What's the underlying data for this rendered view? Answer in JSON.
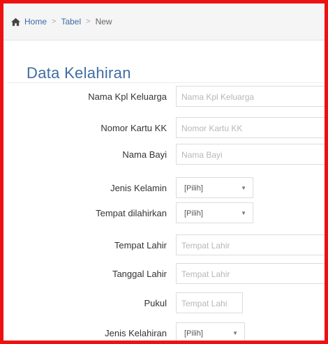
{
  "breadcrumb": {
    "icon": "home-icon",
    "items": [
      "Home",
      "Tabel",
      "New"
    ],
    "separator": ">"
  },
  "form": {
    "title": "Data Kelahiran",
    "fields": [
      {
        "label": "Nama Kpl Keluarga",
        "placeholder": "Nama Kpl Keluarga",
        "type": "text"
      },
      {
        "label": "Nomor Kartu KK",
        "placeholder": "Nomor Kartu KK",
        "type": "text"
      },
      {
        "label": "Nama Bayi",
        "placeholder": "Nama Bayi",
        "type": "text"
      },
      {
        "label": "Jenis Kelamin",
        "value": "[Pilih]",
        "type": "select"
      },
      {
        "label": "Tempat dilahirkan",
        "value": "[Pilih]",
        "type": "select"
      },
      {
        "label": "Tempat Lahir",
        "placeholder": "Tempat Lahir",
        "type": "text"
      },
      {
        "label": "Tanggal Lahir",
        "placeholder": "Tempat Lahir",
        "type": "text"
      },
      {
        "label": "Pukul",
        "placeholder": "Tempat Lahi",
        "type": "text"
      },
      {
        "label": "Jenis Kelahiran",
        "value": "[Pilih]",
        "type": "select"
      }
    ]
  },
  "colors": {
    "frame_border": "#ee1111",
    "title": "#3e6ea3",
    "link": "#3a6aa8"
  }
}
